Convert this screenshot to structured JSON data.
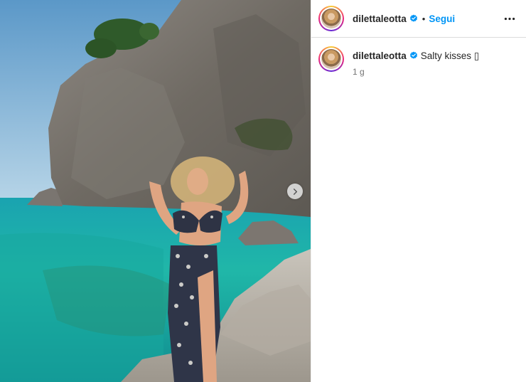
{
  "post": {
    "username": "dilettaleotta",
    "verified": true,
    "follow_label": "Segui",
    "separator": "•",
    "caption_text": "Salty kisses ▯",
    "time_ago": "1 g",
    "has_next_image": true
  },
  "icons": {
    "verified": "verified-badge-icon",
    "more": "more-options-icon",
    "next": "chevron-right-icon"
  },
  "colors": {
    "link_blue": "#0095f6",
    "verified_blue": "#0095f6",
    "text": "#262626",
    "muted": "#737373"
  }
}
